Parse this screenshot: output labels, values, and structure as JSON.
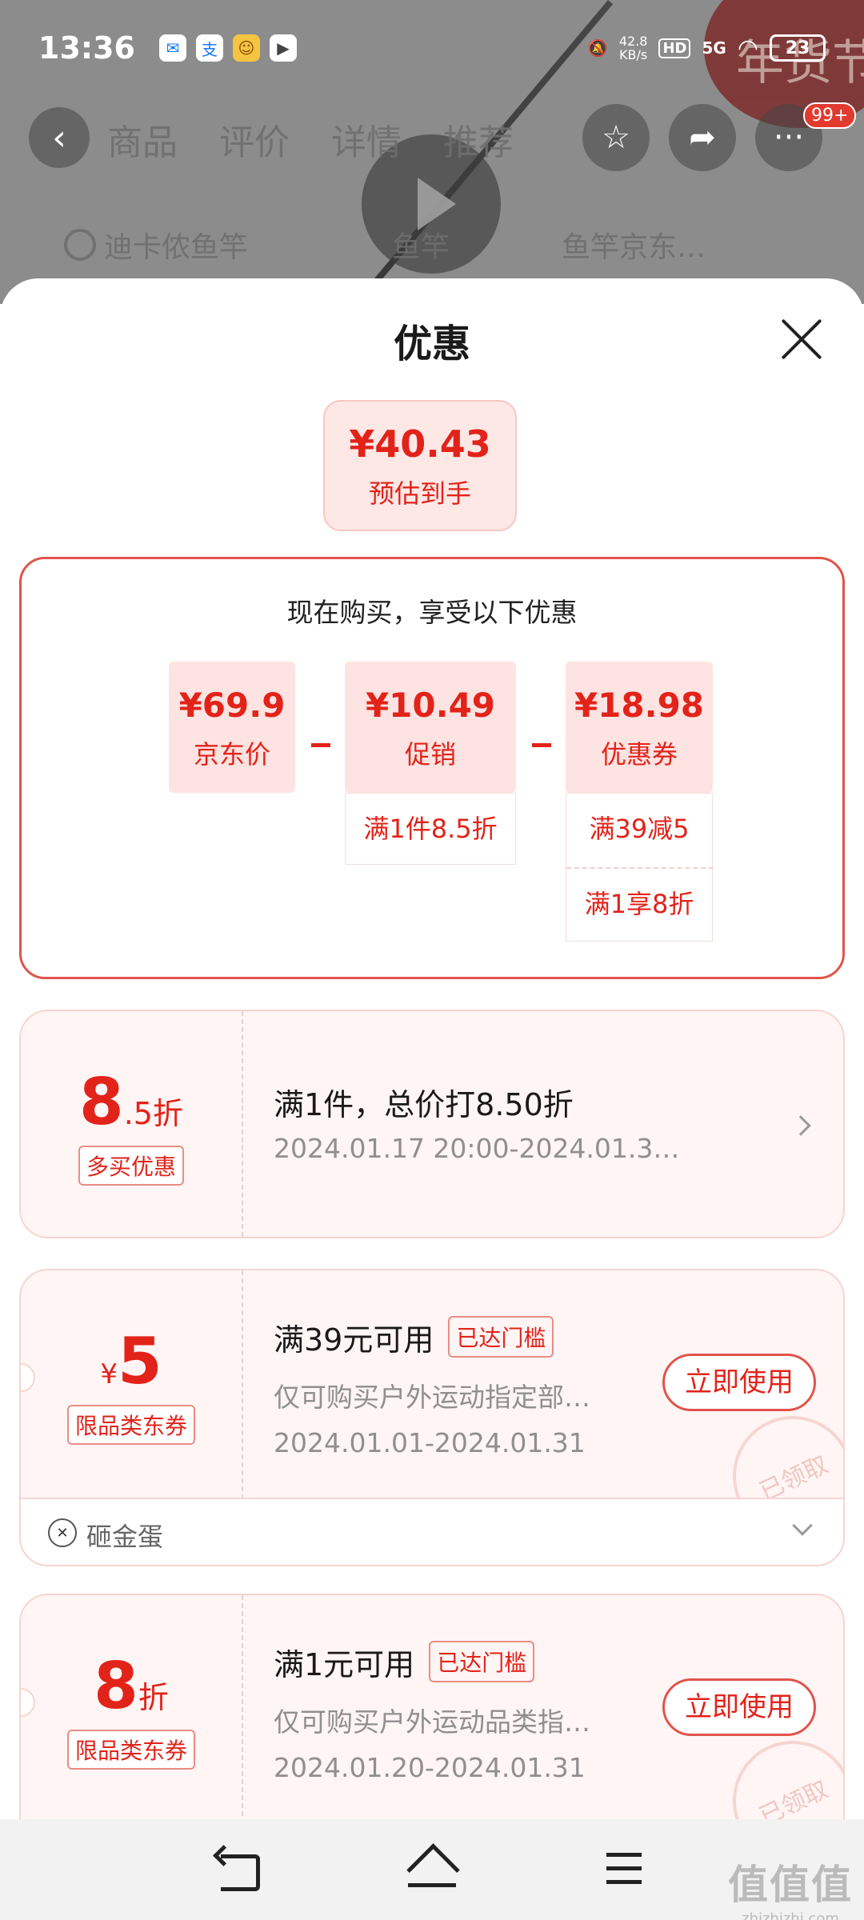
{
  "status_bar": {
    "time": "13:36",
    "app_icons": [
      "mail-icon",
      "alipay-icon",
      "app-icon",
      "video-icon"
    ],
    "speed_top": "42.8",
    "speed_unit": "KB/s",
    "hd": "HD",
    "network": "5G",
    "battery": "23"
  },
  "background_page": {
    "tabs": [
      "商品",
      "评价",
      "详情",
      "推荐"
    ],
    "badge": "99+",
    "search_items": [
      "迪卡侬鱼竿",
      "鱼竿",
      "鱼竿京东…"
    ]
  },
  "sheet": {
    "title": "优惠",
    "estimate": {
      "price": "¥40.43",
      "label": "预估到手"
    },
    "calc": {
      "title": "现在购买，享受以下优惠",
      "items": [
        {
          "amount": "¥69.9",
          "label": "京东价"
        },
        {
          "amount": "¥10.49",
          "label": "促销"
        },
        {
          "amount": "¥18.98",
          "label": "优惠券"
        }
      ],
      "promo_details": [
        "满1件8.5折"
      ],
      "coupon_details": [
        "满39减5",
        "满1享8折"
      ]
    },
    "cards": [
      {
        "big": "8",
        "suffix": ".5折",
        "tag": "多买优惠",
        "title": "满1件，总价打8.50折",
        "subtitle": "2024.01.17 20:00-2024.01.3…"
      },
      {
        "prefix": "¥",
        "big": "5",
        "tag": "限品类东券",
        "title": "满39元可用",
        "reach": "已达门槛",
        "subtitle": "仅可购买户外运动指定部…",
        "date": "2024.01.01-2024.01.31",
        "button": "立即使用",
        "stamp": "已领取",
        "footer": "砸金蛋"
      },
      {
        "big": "8",
        "suffix": "折",
        "tag": "限品类东券",
        "title": "满1元可用",
        "reach": "已达门槛",
        "subtitle": "仅可购买户外运动品类指…",
        "date": "2024.01.20-2024.01.31",
        "button": "立即使用",
        "stamp": "已领取"
      }
    ]
  },
  "watermark": {
    "big": "值值值",
    "small": "zhizhizhi.com"
  }
}
